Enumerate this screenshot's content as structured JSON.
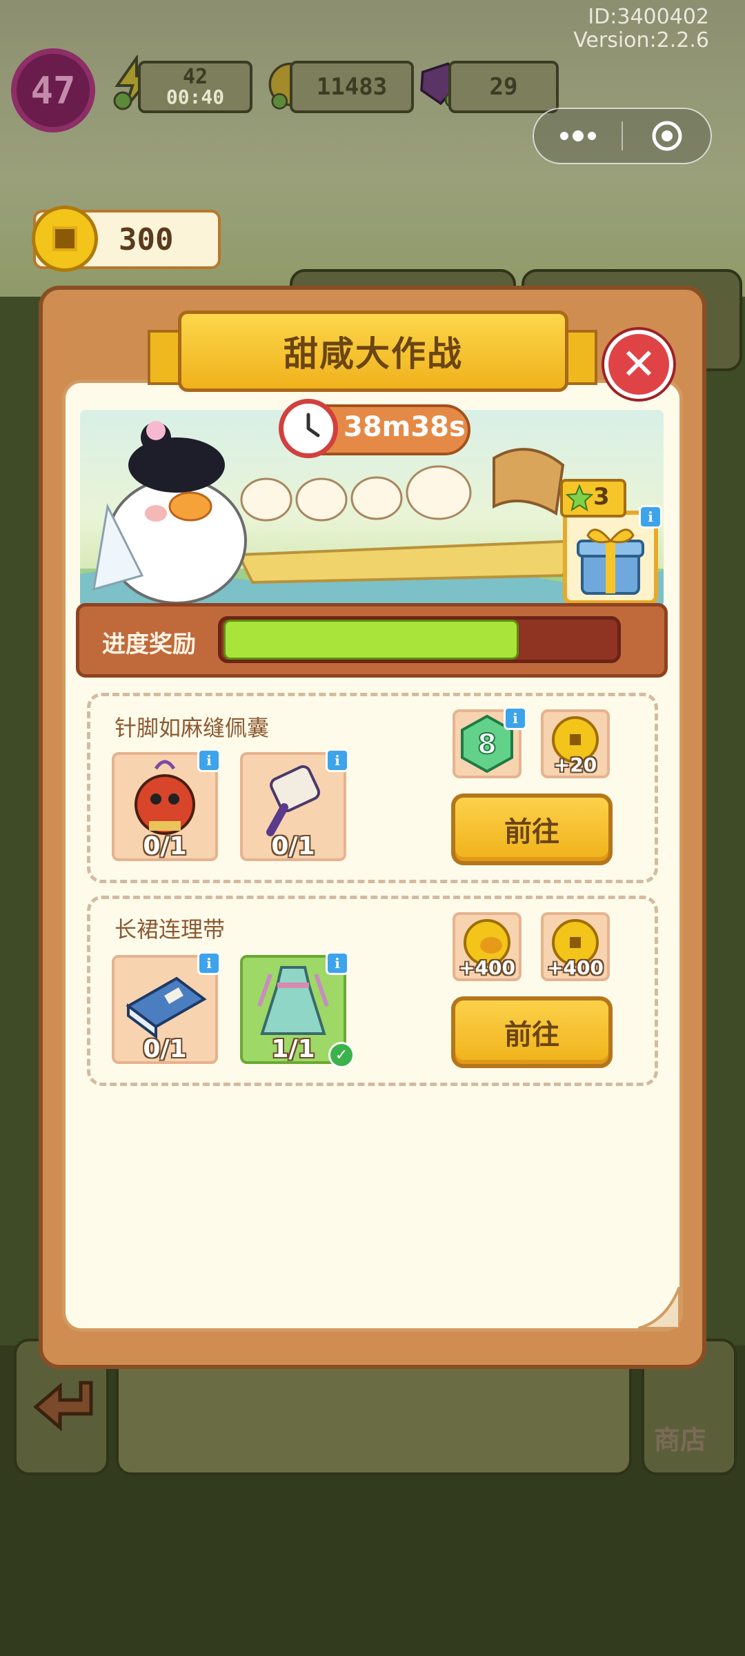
{
  "hud": {
    "user_id": "ID:3400402",
    "version": "Version:2.2.6",
    "level": "47",
    "energy": "42",
    "energy_timer": "00:40",
    "coins": "11483",
    "gems": "29",
    "coin_counter": "300"
  },
  "capsule": {
    "more_icon": "more-dots-icon",
    "close_icon": "target-circle-icon"
  },
  "modal": {
    "title": "甜咸大作战",
    "timer": "38m38s",
    "progress_label": "进度奖励",
    "progress_fraction": 0.75,
    "gift_stars": "3"
  },
  "tasks": [
    {
      "title": "针脚如麻缝佩囊",
      "items": [
        {
          "icon": "sachet-icon",
          "count": "0/1",
          "done": false
        },
        {
          "icon": "fan-scroll-icon",
          "count": "0/1",
          "done": false
        }
      ],
      "rewards": [
        {
          "icon": "green-gem-8-icon",
          "amount": ""
        },
        {
          "icon": "coin-icon",
          "amount": "+20"
        }
      ],
      "button": "前往"
    },
    {
      "title": "长裙连理带",
      "items": [
        {
          "icon": "blue-book-icon",
          "count": "0/1",
          "done": false
        },
        {
          "icon": "hanfu-dress-icon",
          "count": "1/1",
          "done": true
        }
      ],
      "rewards": [
        {
          "icon": "duck-coin-icon",
          "amount": "+400"
        },
        {
          "icon": "coin-icon",
          "amount": "+400"
        }
      ],
      "button": "前往"
    }
  ],
  "bottom": {
    "shop_label": "商店"
  },
  "colors": {
    "accent": "#f0b21c",
    "close": "#e04346",
    "progress": "#a8e43a",
    "panel": "#cf8d52"
  }
}
